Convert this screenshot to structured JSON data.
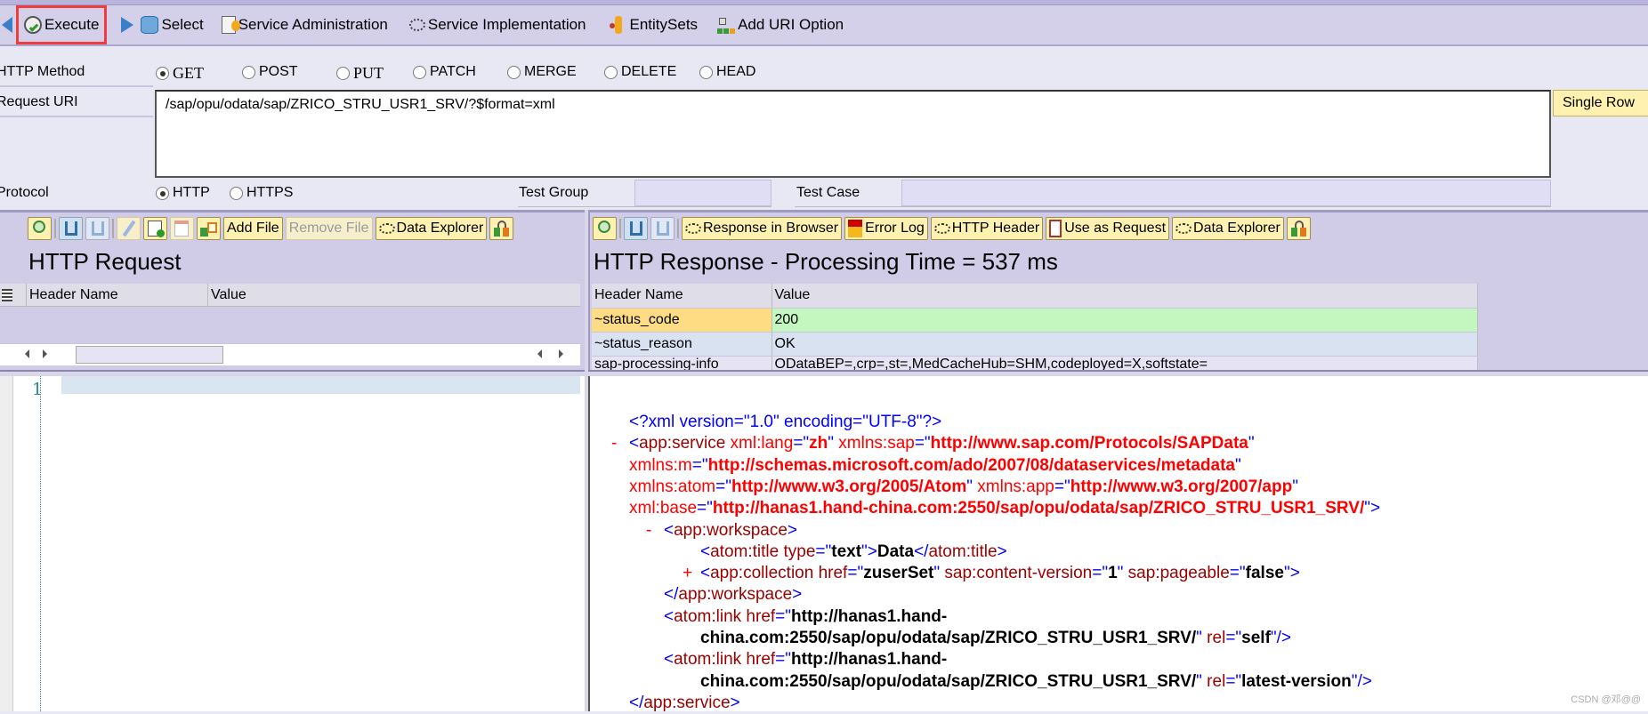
{
  "toolbar": {
    "items": [
      {
        "label": "Execute",
        "icon": "execute-clock-check-icon"
      },
      {
        "label": "Select",
        "icon": "select-database-icon"
      },
      {
        "label": "Service Administration",
        "icon": "service-admin-icon"
      },
      {
        "label": "Service Implementation",
        "icon": "service-implementation-icon"
      },
      {
        "label": "EntitySets",
        "icon": "entitysets-icon"
      },
      {
        "label": "Add URI Option",
        "icon": "add-uri-option-icon"
      }
    ]
  },
  "form": {
    "http_method_label": "HTTP Method",
    "methods": [
      "GET",
      "POST",
      "PUT",
      "PATCH",
      "MERGE",
      "DELETE",
      "HEAD"
    ],
    "selected_method": "GET",
    "request_uri_label": "Request URI",
    "request_uri": "/sap/opu/odata/sap/ZRICO_STRU_USR1_SRV/?$format=xml",
    "single_row_button": "Single Row",
    "protocol_label": "Protocol",
    "protocols": [
      "HTTP",
      "HTTPS"
    ],
    "selected_protocol": "HTTP",
    "test_group_label": "Test Group",
    "test_group_value": "",
    "test_case_label": "Test Case",
    "test_case_value": ""
  },
  "request": {
    "buttons": {
      "add_file": "Add File",
      "remove_file": "Remove File",
      "data_explorer": "Data Explorer"
    },
    "title": "HTTP Request",
    "columns": [
      "Header Name",
      "Value"
    ],
    "editor_line_number": "1"
  },
  "response": {
    "buttons": {
      "response_in_browser": "Response in Browser",
      "error_log": "Error Log",
      "http_header": "HTTP Header",
      "use_as_request": "Use as Request",
      "data_explorer": "Data Explorer"
    },
    "title": "HTTP Response - Processing Time = 537  ms",
    "columns": [
      "Header Name",
      "Value"
    ],
    "rows": [
      {
        "name": "~status_code",
        "value": "200"
      },
      {
        "name": "~status_reason",
        "value": "OK"
      },
      {
        "name": "sap-processing-info",
        "value": "ODataBEP=,crp=,st=,MedCacheHub=SHM,codeployed=X,softstate="
      }
    ],
    "xml_lines": [
      {
        "marker": "",
        "indent": 0,
        "tokens": [
          [
            "b",
            "<?xml version=\"1.0\" encoding=\"UTF-8\"?>"
          ]
        ]
      },
      {
        "marker": "-",
        "indent": 0,
        "tokens": [
          [
            "b",
            "<"
          ],
          [
            "n",
            "app:service"
          ],
          [
            "a",
            " xml:lang"
          ],
          [
            "b",
            "=\""
          ],
          [
            "vr",
            "zh"
          ],
          [
            "b",
            "\""
          ],
          [
            "a",
            " xmlns:sap"
          ],
          [
            "b",
            "=\""
          ],
          [
            "vr",
            "http://www.sap.com/Protocols/SAPData"
          ],
          [
            "b",
            "\""
          ]
        ]
      },
      {
        "marker": "",
        "indent": 0,
        "tokens": [
          [
            "a",
            "xmlns:m"
          ],
          [
            "b",
            "=\""
          ],
          [
            "vr",
            "http://schemas.microsoft.com/ado/2007/08/dataservices/metadata"
          ],
          [
            "b",
            "\""
          ]
        ]
      },
      {
        "marker": "",
        "indent": 0,
        "tokens": [
          [
            "a",
            "xmlns:atom"
          ],
          [
            "b",
            "=\""
          ],
          [
            "vr",
            "http://www.w3.org/2005/Atom"
          ],
          [
            "b",
            "\""
          ],
          [
            "a",
            " xmlns:app"
          ],
          [
            "b",
            "=\""
          ],
          [
            "vr",
            "http://www.w3.org/2007/app"
          ],
          [
            "b",
            "\""
          ]
        ]
      },
      {
        "marker": "",
        "indent": 0,
        "tokens": [
          [
            "a",
            "xml:base"
          ],
          [
            "b",
            "=\""
          ],
          [
            "vr",
            "http://hanas1.hand-china.com:2550/sap/opu/odata/sap/ZRICO_STRU_USR1_SRV/"
          ],
          [
            "b",
            "\">"
          ]
        ]
      },
      {
        "marker": "-",
        "indent": 1,
        "tokens": [
          [
            "b",
            "<"
          ],
          [
            "n",
            "app:workspace"
          ],
          [
            "b",
            ">"
          ]
        ]
      },
      {
        "marker": "",
        "indent": 2,
        "tokens": [
          [
            "b",
            "<"
          ],
          [
            "n",
            "atom:title"
          ],
          [
            "n",
            " type"
          ],
          [
            "b",
            "=\""
          ],
          [
            "v",
            "text"
          ],
          [
            "b",
            "\">"
          ],
          [
            "x",
            "Data"
          ],
          [
            "b",
            "</"
          ],
          [
            "n",
            "atom:title"
          ],
          [
            "b",
            ">"
          ]
        ]
      },
      {
        "marker": "+",
        "indent": 2,
        "tokens": [
          [
            "b",
            "<"
          ],
          [
            "n",
            "app:collection"
          ],
          [
            "n",
            " href"
          ],
          [
            "b",
            "=\""
          ],
          [
            "v",
            "zuserSet"
          ],
          [
            "b",
            "\""
          ],
          [
            "n",
            " sap:content-version"
          ],
          [
            "b",
            "=\""
          ],
          [
            "v",
            "1"
          ],
          [
            "b",
            "\""
          ],
          [
            "n",
            " sap:pageable"
          ],
          [
            "b",
            "=\""
          ],
          [
            "v",
            "false"
          ],
          [
            "b",
            "\">"
          ]
        ]
      },
      {
        "marker": "",
        "indent": 1,
        "tokens": [
          [
            "b",
            "</"
          ],
          [
            "n",
            "app:workspace"
          ],
          [
            "b",
            ">"
          ]
        ]
      },
      {
        "marker": "",
        "indent": 1,
        "tokens": [
          [
            "b",
            "<"
          ],
          [
            "n",
            "atom:link"
          ],
          [
            "n",
            " href"
          ],
          [
            "b",
            "=\""
          ],
          [
            "v",
            "http://hanas1.hand-"
          ]
        ]
      },
      {
        "marker": "",
        "indent": 2,
        "tokens": [
          [
            "v",
            "china.com:2550/sap/opu/odata/sap/ZRICO_STRU_USR1_SRV/"
          ],
          [
            "b",
            "\""
          ],
          [
            "n",
            " rel"
          ],
          [
            "b",
            "=\""
          ],
          [
            "v",
            "self"
          ],
          [
            "b",
            "\"/>"
          ]
        ]
      },
      {
        "marker": "",
        "indent": 1,
        "tokens": [
          [
            "b",
            "<"
          ],
          [
            "n",
            "atom:link"
          ],
          [
            "n",
            " href"
          ],
          [
            "b",
            "=\""
          ],
          [
            "v",
            "http://hanas1.hand-"
          ]
        ]
      },
      {
        "marker": "",
        "indent": 2,
        "tokens": [
          [
            "v",
            "china.com:2550/sap/opu/odata/sap/ZRICO_STRU_USR1_SRV/"
          ],
          [
            "b",
            "\""
          ],
          [
            "n",
            " rel"
          ],
          [
            "b",
            "=\""
          ],
          [
            "v",
            "latest-version"
          ],
          [
            "b",
            "\"/>"
          ]
        ]
      },
      {
        "marker": "",
        "indent": 0,
        "tokens": [
          [
            "b",
            "</"
          ],
          [
            "n",
            "app:service"
          ],
          [
            "b",
            ">"
          ]
        ]
      }
    ]
  },
  "watermark": "CSDN @邓@@",
  "colors": {
    "toolbar_bg": "#d4d0ea",
    "highlight_red": "#f03c3c",
    "status_code_name_bg": "#fddc84",
    "status_code_value_bg": "#c4f6c0",
    "button_bg": "#fff2b0"
  }
}
